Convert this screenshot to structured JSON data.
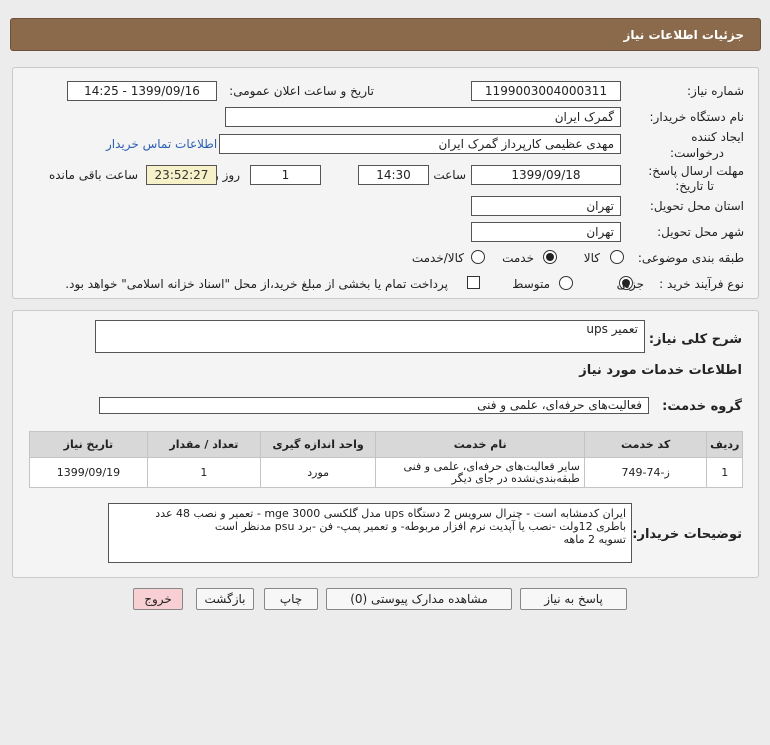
{
  "header": {
    "title": "جزئیات اطلاعات نیاز"
  },
  "form": {
    "need_number_label": "شماره نیاز:",
    "need_number": "1199003004000311",
    "announce_label": "تاریخ و ساعت اعلان عمومی:",
    "announce_value": "1399/09/16 - 14:25",
    "buyer_org_label": "نام دستگاه خریدار:",
    "buyer_org": "گمرک ایران",
    "creator_label_1": "ایجاد کننده",
    "creator_label_2": "درخواست:",
    "creator": "مهدی عظیمی کارپرداز گمرک ایران",
    "contact_link": "اطلاعات تماس خریدار",
    "deadline_label_1": "مهلت ارسال پاسخ:",
    "deadline_label_2": "تا تاریخ:",
    "deadline_date": "1399/09/18",
    "time_label": "ساعت",
    "deadline_time": "14:30",
    "days_value": "1",
    "days_label": "روز و",
    "remaining": "23:52:27",
    "remaining_label": "ساعت باقی مانده",
    "province_label": "استان محل تحویل:",
    "province": "تهران",
    "city_label": "شهر محل تحویل:",
    "city": "تهران",
    "category_label": "طبقه بندی موضوعی:",
    "category_options": [
      "کالا",
      "خدمت",
      "کالا/خدمت"
    ],
    "category_selected": "خدمت",
    "process_label": "نوع فرآیند خرید :",
    "process_options": [
      "جزیی",
      "متوسط"
    ],
    "process_selected": "جزیی",
    "payment_note": "پرداخت تمام یا بخشی از مبلغ خرید،از محل \"اسناد خزانه اسلامی\" خواهد بود."
  },
  "summary": {
    "label": "شرح کلی نیاز:",
    "value": "تعمیر ups",
    "services_title": "اطلاعات خدمات مورد نیاز",
    "group_label": "گروه خدمت:",
    "group_value": "فعالیت‌های حرفه‌ای، علمی و فنی"
  },
  "table": {
    "headers": [
      "ردیف",
      "کد خدمت",
      "نام خدمت",
      "واحد اندازه گیری",
      "تعداد / مقدار",
      "تاریخ نیاز"
    ],
    "rows": [
      [
        "1",
        "ز-74-749",
        "سایر فعالیت‌های حرفه‌ای، علمی و فنی طبقه‌بندی‌نشده در جای دیگر",
        "مورد",
        "1",
        "1399/09/19"
      ]
    ]
  },
  "buyer_notes": {
    "label": "توضیحات خریدار:",
    "line1": "ایران کدمشابه است - چنرال سرویس 2 دستگاه  ups مدل گلکسی mge 3000 - تعمیر و نصب 48 عدد",
    "line2": "باطری 12ولت -نصب یا آپدیت نرم افزار مربوطه- و تعمیر پمپ- فن -برد psu مدنظر است",
    "line3": "تسویه 2 ماهه"
  },
  "buttons": {
    "reply": "پاسخ به نیاز",
    "attachments": "مشاهده مدارک پیوستی (0)",
    "print": "چاپ",
    "back": "بازگشت",
    "exit": "خروج"
  },
  "colors": {
    "header_bg": "#8a6a4a",
    "exit_button_bg": "#f8cfd2",
    "remaining_bg": "#f6f1c8",
    "link": "#2b5fb3"
  }
}
